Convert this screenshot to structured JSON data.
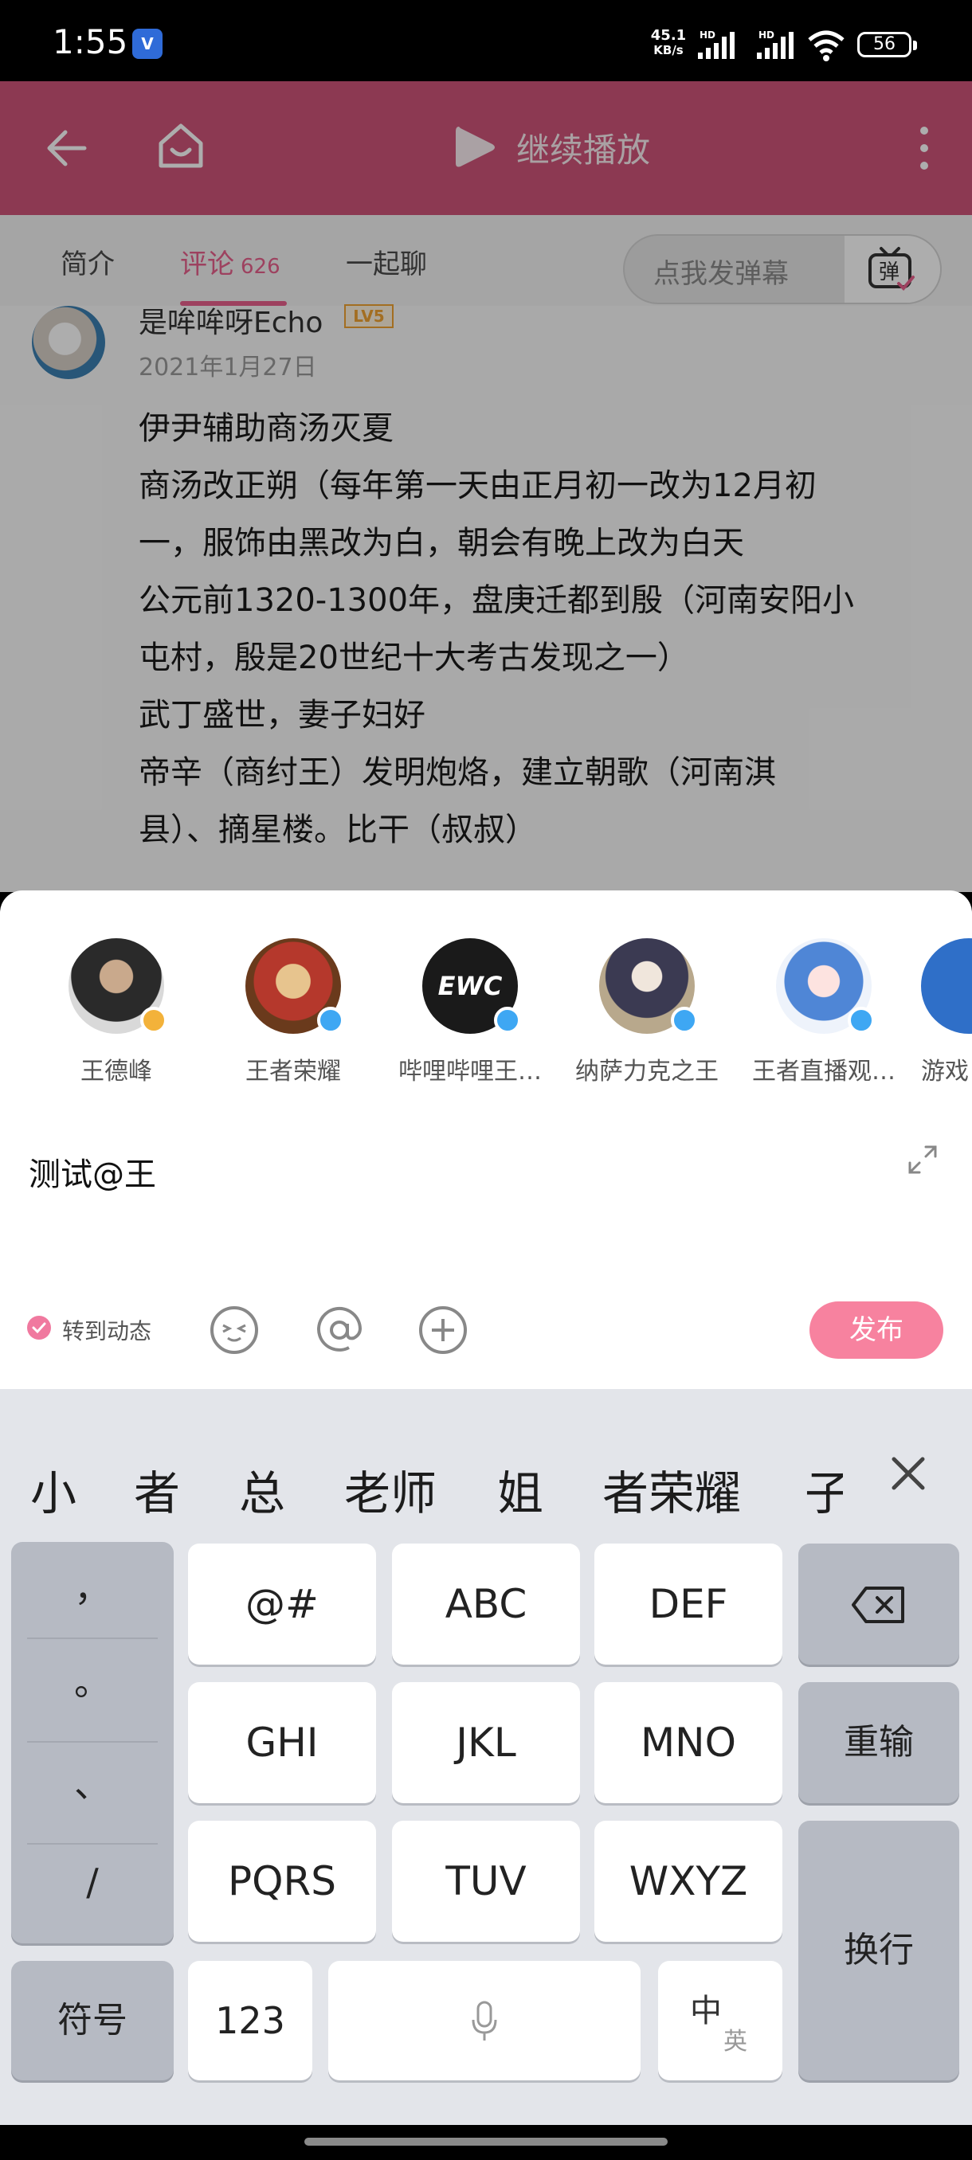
{
  "status_bar": {
    "time": "1:55",
    "net_speed_value": "45.1",
    "net_speed_unit": "KB/s",
    "signal_label_1": "HD",
    "signal_label_2": "HD",
    "battery": "56"
  },
  "header": {
    "continue_play": "继续播放"
  },
  "tabs": {
    "intro": "简介",
    "comments": "评论",
    "comments_count": "626",
    "chat": "一起聊",
    "danmaku_placeholder": "点我发弹幕",
    "danmaku_button": "弹"
  },
  "comment": {
    "username": "是哞哞呀Echo",
    "level": "LV5",
    "date": "2021年1月27日",
    "lines": [
      "伊尹辅助商汤灭夏",
      "商汤改正朔（每年第一天由正月初一改为12月初",
      "一，服饰由黑改为白，朝会有晚上改为白天",
      "公元前1320-1300年，盘庚迁都到殷（河南安阳小",
      "屯村，殷是20世纪十大考古发现之一）",
      "武丁盛世，妻子妇好",
      "帝辛（商纣王）发明炮烙，建立朝歌（河南淇",
      "县）、摘星楼。比干（叔叔）"
    ]
  },
  "mention_suggestions": [
    {
      "name": "王德峰",
      "badge_color": "#f3b23a"
    },
    {
      "name": "王者荣耀",
      "badge_color": "#3ea7f3"
    },
    {
      "name": "哔哩哔哩王…",
      "badge_color": "#3ea7f3"
    },
    {
      "name": "纳萨力克之王",
      "badge_color": "#3ea7f3"
    },
    {
      "name": "王者直播观…",
      "badge_color": "#3ea7f3"
    },
    {
      "name": "游戏",
      "badge_color": "#3ea7f3"
    }
  ],
  "reply_box": {
    "input_value": "测试@王",
    "repost_label": "转到动态",
    "publish": "发布"
  },
  "keyboard": {
    "candidates": [
      "小",
      "者",
      "总",
      "老师",
      "姐",
      "者荣耀",
      "子"
    ],
    "punct": [
      "，",
      "。",
      "、",
      "/"
    ],
    "keys": {
      "at": "@#",
      "abc": "ABC",
      "def": "DEF",
      "ghi": "GHI",
      "jkl": "JKL",
      "mno": "MNO",
      "pqrs": "PQRS",
      "tuv": "TUV",
      "wxyz": "WXYZ",
      "reenter": "重输",
      "enter": "换行",
      "symbol": "符号",
      "num": "123",
      "lang_zh": "中",
      "lang_en": "英"
    }
  },
  "colors": {
    "brand_pink": "#cf5479",
    "accent_pink": "#e8618c",
    "publish_pink": "#f7829f"
  }
}
